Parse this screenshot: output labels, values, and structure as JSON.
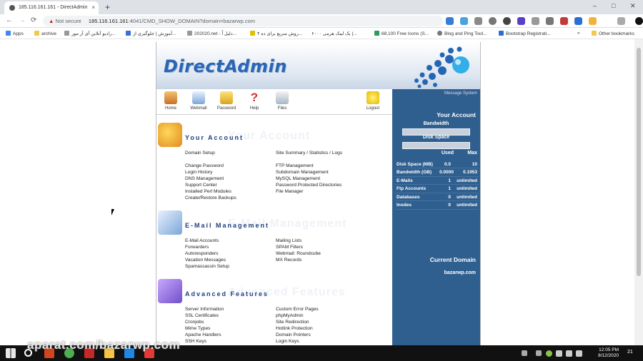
{
  "browser": {
    "tab_title": "185.116.161.161 - DirectAdmin",
    "tab_close": "×",
    "new_tab": "+",
    "window_controls": [
      "–",
      "□",
      "✕"
    ],
    "nav_back": "←",
    "nav_forward": "→",
    "nav_reload": "⟳",
    "security_label": "Not secure",
    "url_host": "185.116.161.161",
    "url_path": ":4041/CMD_SHOW_DOMAIN?domain=bazarwp.com",
    "bookmarks": [
      "Apps",
      "archive",
      "رادیو آنلاین آی آر مور...",
      "آموزش | جلوگیری از...",
      "202020.net - دلیل اً...",
      "۴ روش سریع برای ده...",
      "۶۰۰۰ بک لینک هرمی (...",
      "68,100 Free Icons (S...",
      "Blog and Ping Tool...",
      "Bootstrap Registrati..."
    ],
    "more_bookmarks": "»",
    "other_bookmarks": "Other bookmarks"
  },
  "directadmin": {
    "logo": "DirectAdmin",
    "toolbar": [
      "Home",
      "Webmail",
      "Password",
      "Help",
      "Files",
      "Logout"
    ],
    "sections": [
      {
        "title": "Your Account",
        "ghost": "Your Account",
        "left": [
          "Domain Setup",
          "Change Password",
          "Login History",
          "DNS Management",
          "Support Center",
          "Installed Perl Modules",
          "Create/Restore Backups"
        ],
        "right": [
          "Site Summary / Statistics / Logs",
          "FTP Management",
          "Subdomain Management",
          "MySQL Management",
          "Password Protected Directories",
          "File Manager"
        ]
      },
      {
        "title": "E-Mail Management",
        "ghost": "E-Mail Management",
        "left": [
          "E-Mail Accounts",
          "Forwarders",
          "Autoresponders",
          "Vacation Messages",
          "Spamassassin Setup"
        ],
        "right": [
          "Mailing Lists",
          "SPAM Filters",
          "Webmail: Roundcube",
          "MX Records"
        ]
      },
      {
        "title": "Advanced Features",
        "ghost": "Advanced Features",
        "left": [
          "Server Information",
          "SSL Certificates",
          "Cronjobs",
          "Mime Types",
          "Apache Handlers",
          "SSH Keys"
        ],
        "right": [
          "Custom Error Pages",
          "phpMyAdmin",
          "Site Redirection",
          "Hotlink Protection",
          "Domain Pointers",
          "Login Keys"
        ]
      }
    ],
    "sidebar": {
      "message_system": "Message System",
      "your_account": "Your Account",
      "bandwidth": "Bandwidth",
      "bandwidth_used_fraction": 0,
      "disk_space": "Disk Space",
      "disk_used_fraction": 0,
      "col_used": "Used",
      "col_max": "Max",
      "stats": [
        {
          "label": "Disk Space (MB)",
          "used": "0.0",
          "max": "10"
        },
        {
          "label": "Bandwidth (GB)",
          "used": "0.0000",
          "max": "0.1953"
        },
        {
          "label": "E-Mails",
          "used": "1",
          "max": "unlimited"
        },
        {
          "label": "Ftp Accounts",
          "used": "1",
          "max": "unlimited"
        },
        {
          "label": "Databases",
          "used": "0",
          "max": "unlimited"
        },
        {
          "label": "Inodes",
          "used": "0",
          "max": "unlimited"
        }
      ],
      "current_domain_heading": "Current Domain",
      "current_domain": "bazarwp.com"
    }
  },
  "taskbar": {
    "time": "12:05 PM",
    "date": "8/12/2020",
    "notifications": "21"
  },
  "watermark": "aparat.com/bazarwp.com",
  "colors": {
    "sidebar": "#2f5f8f",
    "section_title": "#1e3f80",
    "logo": "#2b65b3"
  }
}
